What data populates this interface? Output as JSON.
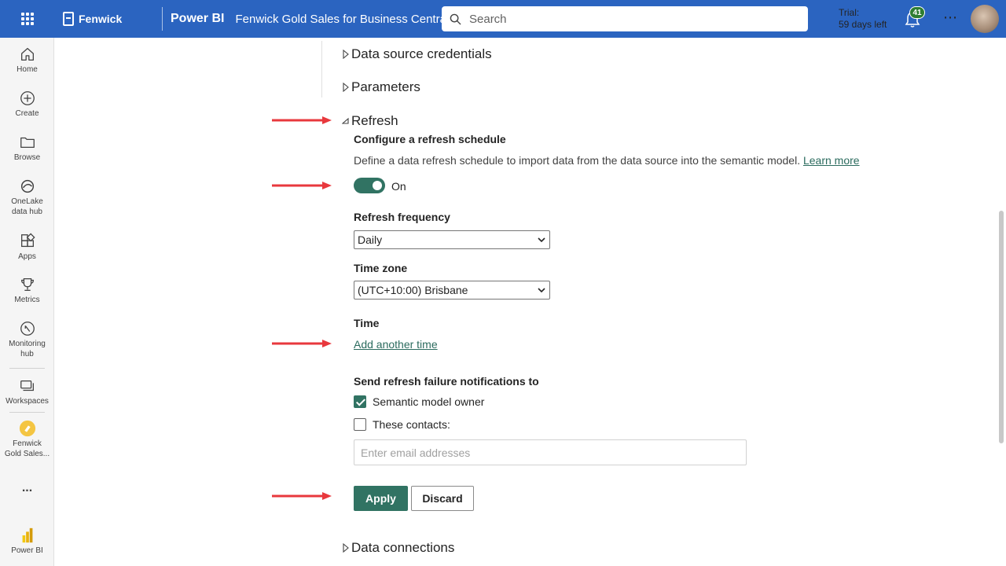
{
  "header": {
    "brand": "Fenwick",
    "product": "Power BI",
    "report_title": "Fenwick Gold Sales for Business Central",
    "search_placeholder": "Search",
    "trial_line1": "Trial:",
    "trial_line2": "59 days left",
    "notification_count": "41",
    "more_glyph": "⋯"
  },
  "nav": {
    "items": [
      {
        "label": "Home",
        "icon": "home-icon"
      },
      {
        "label": "Create",
        "icon": "plus-circle-icon"
      },
      {
        "label": "Browse",
        "icon": "folder-icon"
      },
      {
        "label_line1": "OneLake",
        "label_line2": "data hub",
        "icon": "onelake-icon"
      },
      {
        "label": "Apps",
        "icon": "apps-icon"
      },
      {
        "label": "Metrics",
        "icon": "trophy-icon"
      },
      {
        "label_line1": "Monitoring",
        "label_line2": "hub",
        "icon": "monitoring-icon"
      },
      {
        "label": "Workspaces",
        "icon": "workspaces-icon"
      },
      {
        "label_line1": "Fenwick",
        "label_line2": "Gold Sales...",
        "icon": "workspace-logo-icon"
      },
      {
        "label": "...",
        "icon": "more-icon"
      },
      {
        "label": "Power BI",
        "icon": "powerbi-logo-icon"
      }
    ]
  },
  "sections": {
    "data_source_credentials": "Data source credentials",
    "parameters": "Parameters",
    "refresh": "Refresh",
    "data_connections": "Data connections"
  },
  "refresh": {
    "configure_title": "Configure a refresh schedule",
    "description": "Define a data refresh schedule to import data from the data source into the semantic model.",
    "learn_more": "Learn more",
    "toggle_label": "On",
    "toggle_on": true,
    "frequency_label": "Refresh frequency",
    "frequency_value": "Daily",
    "timezone_label": "Time zone",
    "timezone_value": "(UTC+10:00) Brisbane",
    "time_label": "Time",
    "add_time": "Add another time",
    "notify_label": "Send refresh failure notifications to",
    "owner_option": "Semantic model owner",
    "owner_checked": true,
    "contacts_option": "These contacts:",
    "contacts_checked": false,
    "email_placeholder": "Enter email addresses",
    "apply": "Apply",
    "discard": "Discard"
  },
  "colors": {
    "header_bg": "#2b64c0",
    "accent": "#317363",
    "annotation_arrow": "#e8383d"
  }
}
